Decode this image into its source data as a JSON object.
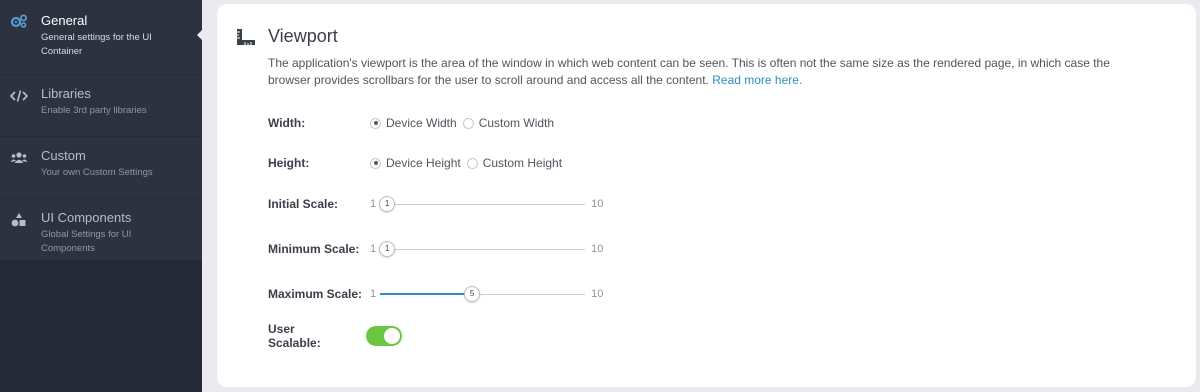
{
  "sidebar": {
    "items": [
      {
        "title": "General",
        "desc": "General settings for the UI Container",
        "icon": "cogs-icon",
        "active": true
      },
      {
        "title": "Libraries",
        "desc": "Enable 3rd party libraries",
        "icon": "code-icon",
        "active": false
      },
      {
        "title": "Custom",
        "desc": "Your own Custom Settings",
        "icon": "users-icon",
        "active": false
      },
      {
        "title": "UI Components",
        "desc": "Global Settings for UI Components",
        "icon": "shapes-icon",
        "active": false
      }
    ]
  },
  "viewport": {
    "title": "Viewport",
    "intro": "The application's viewport is the area of the window in which web content can be seen. This is often not the same size as the rendered page, in which case the browser provides scrollbars for the user to scroll around and access all the content.",
    "read_more": "Read more here.",
    "width": {
      "label": "Width:",
      "options": [
        "Device Width",
        "Custom Width"
      ],
      "selected": "Device Width"
    },
    "height": {
      "label": "Height:",
      "options": [
        "Device Height",
        "Custom Height"
      ],
      "selected": "Device Height"
    },
    "initial_scale": {
      "label": "Initial Scale:",
      "min": "1",
      "max": "10",
      "value": "1"
    },
    "minimum_scale": {
      "label": "Minimum Scale:",
      "min": "1",
      "max": "10",
      "value": "1"
    },
    "maximum_scale": {
      "label": "Maximum Scale:",
      "min": "1",
      "max": "10",
      "value": "5"
    },
    "user_scalable": {
      "label": "User Scalable:",
      "on": true
    }
  },
  "colors": {
    "sidebar_bg": "#232936",
    "accent_blue": "#2b8fc3",
    "toggle_green": "#6cc644"
  }
}
